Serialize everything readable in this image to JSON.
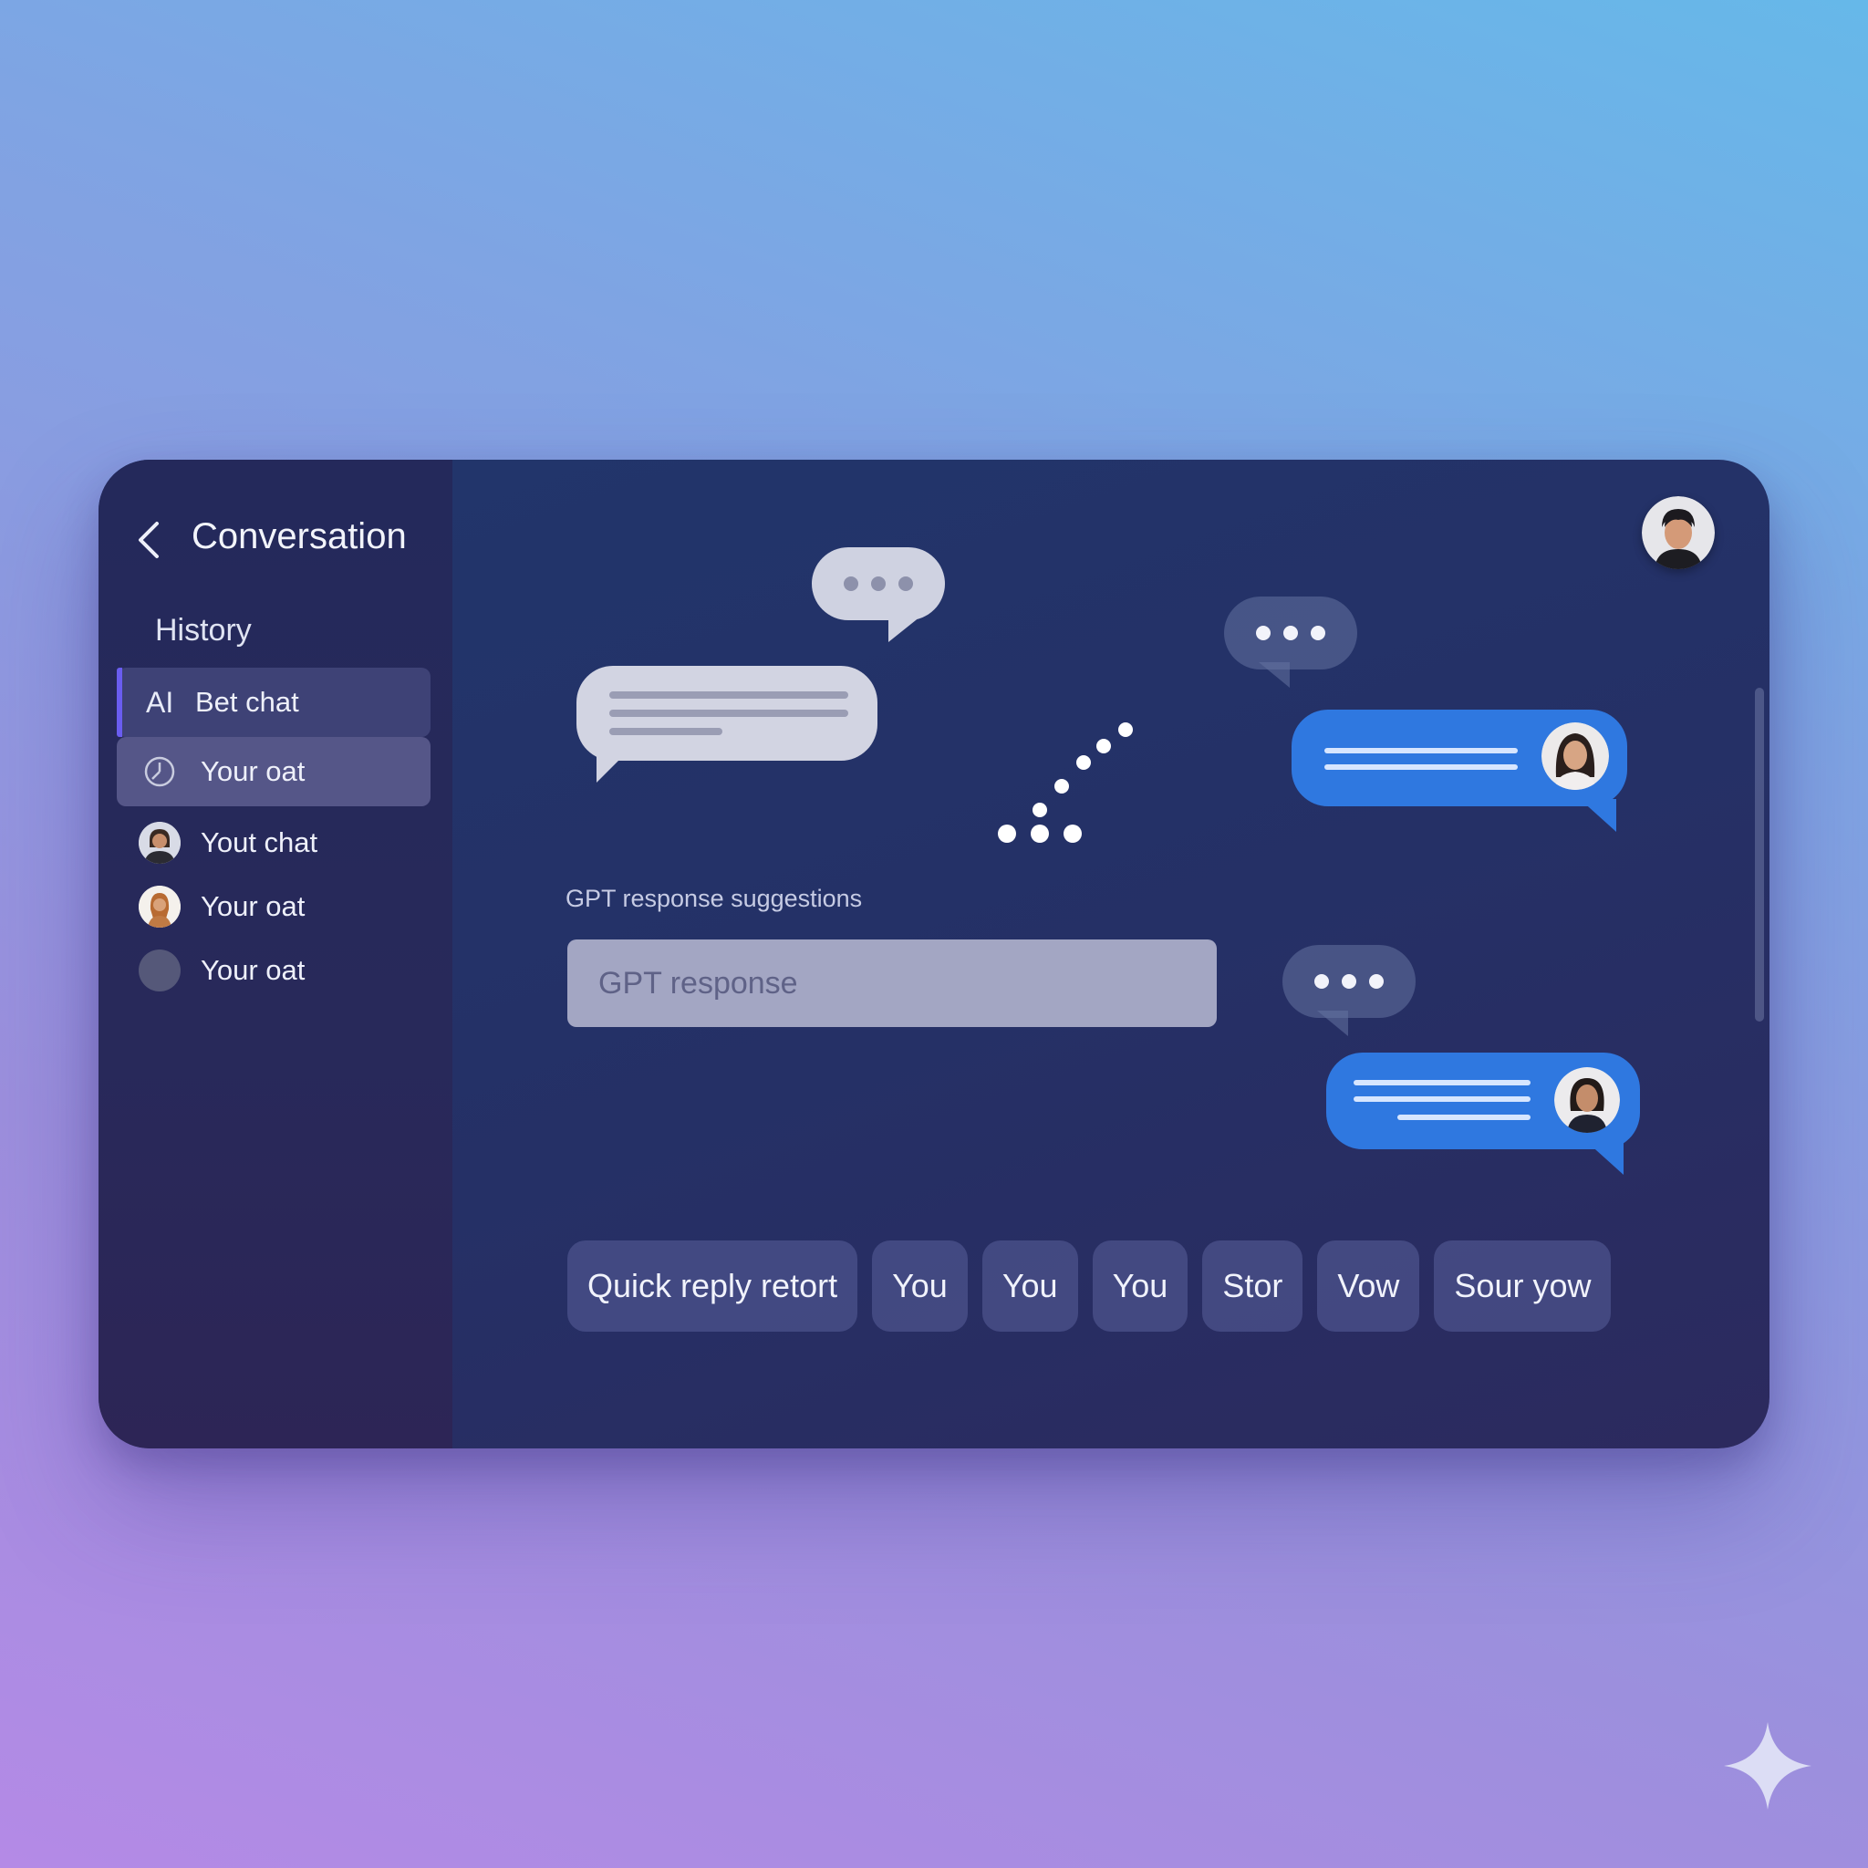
{
  "header": {
    "title": "Conversation",
    "back_icon": "chevron-left-icon"
  },
  "sidebar": {
    "section_label": "History",
    "items": [
      {
        "glyph": "AI",
        "label": "Bet chat",
        "state": "active"
      },
      {
        "icon": "clock-icon",
        "label": "Your oat",
        "state": "selected"
      },
      {
        "icon": "avatar-icon",
        "label": "Yout chat"
      },
      {
        "icon": "avatar-icon",
        "label": "Your oat"
      },
      {
        "icon": "avatar-placeholder-icon",
        "label": "Your oat"
      }
    ]
  },
  "main": {
    "suggestions_label": "GPT response suggestions",
    "input": {
      "placeholder": "GPT response",
      "value": ""
    },
    "quick_replies": [
      "Quick reply retort",
      "You",
      "You",
      "You",
      "Stor",
      "Vow",
      "Sour yow"
    ]
  },
  "colors": {
    "accent": "#6a5df0",
    "blue_bubble": "#2f78e0",
    "grey_bubble": "#d2d4e2",
    "card_bg": "#21366c"
  }
}
